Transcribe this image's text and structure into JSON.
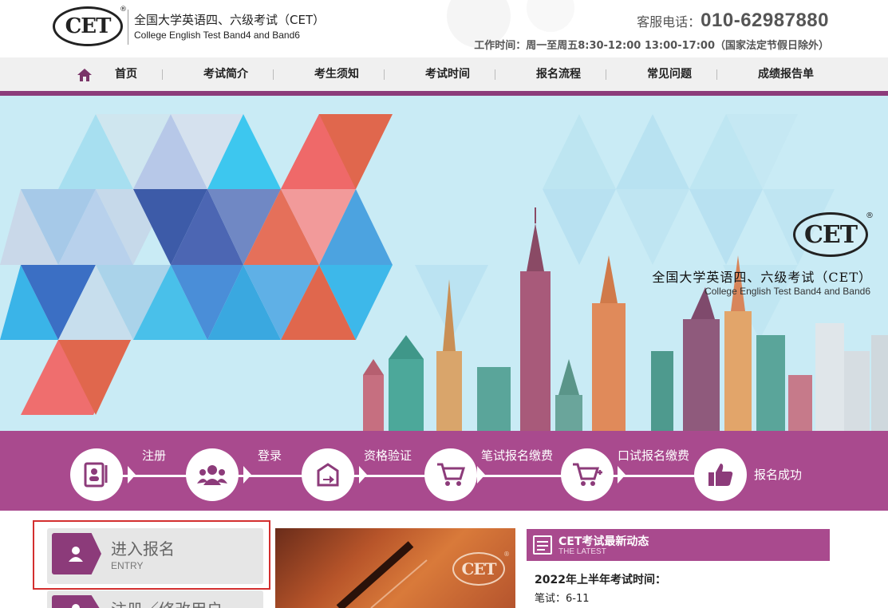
{
  "header": {
    "logo_text": "CET",
    "logo_mark": "®",
    "title_cn": "全国大学英语四、六级考试（CET）",
    "title_en": "College English Test Band4 and Band6",
    "phone_label": "客服电话：",
    "phone_number": "010-62987880",
    "hours": "工作时间：周一至周五8:30-12:00 13:00-17:00（国家法定节假日除外）"
  },
  "nav": {
    "home_icon": "home-icon",
    "items": [
      {
        "label": "首页"
      },
      {
        "label": "考试简介"
      },
      {
        "label": "考生须知"
      },
      {
        "label": "考试时间"
      },
      {
        "label": "报名流程"
      },
      {
        "label": "常见问题"
      },
      {
        "label": "成绩报告单"
      }
    ]
  },
  "banner": {
    "logo_text": "CET",
    "logo_mark": "®",
    "title_cn": "全国大学英语四、六级考试（CET）",
    "title_en": "College English Test Band4 and Band6"
  },
  "steps": [
    {
      "label": "注册",
      "icon": "register-icon"
    },
    {
      "label": "登录",
      "icon": "users-icon"
    },
    {
      "label": "资格验证",
      "icon": "verify-icon"
    },
    {
      "label": "笔试报名缴费",
      "icon": "cart-icon"
    },
    {
      "label": "口试报名缴费",
      "icon": "cart-plus-icon"
    },
    {
      "label": "报名成功",
      "icon": "thumbs-up-icon"
    }
  ],
  "entry": {
    "title": "进入报名",
    "subtitle": "ENTRY",
    "icon": "user-icon"
  },
  "entry2": {
    "title": "注册／修改用户"
  },
  "photo": {
    "logo_text": "CET",
    "logo_mark": "®"
  },
  "news": {
    "title": "CET考试最新动态",
    "subtitle": "THE LATEST",
    "item_title": "2022年上半年考试时间：",
    "item_line": "笔试：6-11"
  },
  "colors": {
    "brand": "#a94a8e",
    "brand_dark": "#8c3b7a",
    "highlight_border": "#d32f2f"
  }
}
